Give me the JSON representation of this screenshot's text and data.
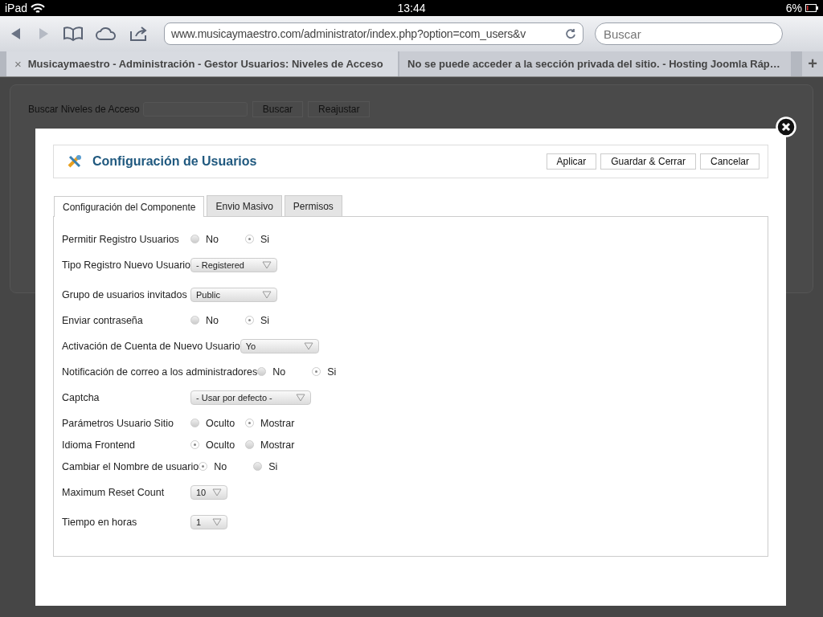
{
  "status_bar": {
    "device": "iPad",
    "time": "13:44",
    "battery": "6%"
  },
  "toolbar": {
    "url": "www.musicaymaestro.com/administrator/index.php?option=com_users&v",
    "search": {
      "placeholder": "Buscar"
    }
  },
  "browser_tabs": [
    {
      "title": "Musicaymaestro - Administración - Gestor Usuarios: Niveles de Acceso",
      "selected": true,
      "close": "×"
    },
    {
      "title": "No se puede acceder a la sección privada del sitio. - Hosting Joomla Ráp…",
      "selected": false
    }
  ],
  "new_tab": "+",
  "background_page": {
    "search_label": "Buscar Niveles de Acceso",
    "buttons": [
      "Buscar",
      "Reajustar"
    ]
  },
  "modal": {
    "title": "Configuración de Usuarios",
    "buttons": [
      "Aplicar",
      "Guardar & Cerrar",
      "Cancelar"
    ],
    "tabs": [
      {
        "label": "Configuración del Componente",
        "selected": true
      },
      {
        "label": "Envio Masivo",
        "selected": false
      },
      {
        "label": "Permisos",
        "selected": false
      }
    ],
    "fields": [
      {
        "kind": "radio",
        "label": "Permitir Registro Usuarios",
        "options": [
          {
            "label": "No",
            "selected": false
          },
          {
            "label": "Si",
            "selected": true
          }
        ]
      },
      {
        "kind": "select",
        "label": "Tipo Registro Nuevo Usuario",
        "value": "- Registered"
      },
      {
        "kind": "select",
        "label": "Grupo de usuarios invitados",
        "value": "Public"
      },
      {
        "kind": "radio",
        "label": "Enviar contraseña",
        "options": [
          {
            "label": "No",
            "selected": false
          },
          {
            "label": "Si",
            "selected": true
          }
        ]
      },
      {
        "kind": "select",
        "label": "Activación de Cuenta de Nuevo Usuario",
        "value": "Yo"
      },
      {
        "kind": "radio",
        "label": "Notificación de correo a los administradores",
        "options": [
          {
            "label": "No",
            "selected": false
          },
          {
            "label": "Si",
            "selected": true
          }
        ]
      },
      {
        "kind": "select",
        "label": "Captcha",
        "value": "- Usar por defecto -"
      },
      {
        "kind": "radio",
        "label": "Parámetros Usuario Sitio",
        "options": [
          {
            "label": "Oculto",
            "selected": false
          },
          {
            "label": "Mostrar",
            "selected": true
          }
        ]
      },
      {
        "kind": "radio",
        "label": "Idioma Frontend",
        "options": [
          {
            "label": "Oculto",
            "selected": true
          },
          {
            "label": "Mostrar",
            "selected": false
          }
        ]
      },
      {
        "kind": "radio",
        "label": "Cambiar el Nombre de usuario",
        "options": [
          {
            "label": "No",
            "selected": true
          },
          {
            "label": "Si",
            "selected": false
          }
        ]
      },
      {
        "kind": "small-select",
        "label": "Maximum Reset Count",
        "value": "10"
      },
      {
        "kind": "small-select",
        "label": "Tiempo en horas",
        "value": "1"
      }
    ]
  }
}
